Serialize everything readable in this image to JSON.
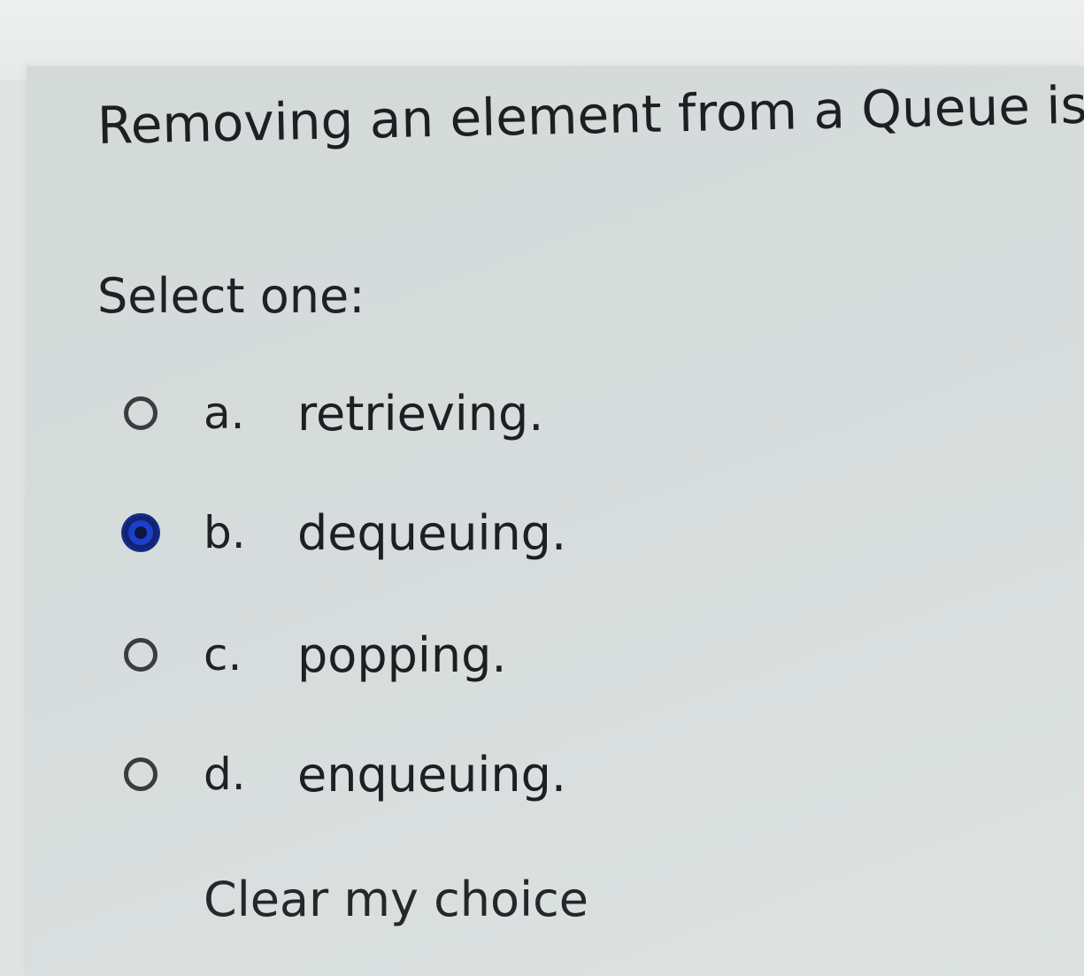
{
  "question": {
    "text": "Removing an element from a Queue is",
    "prompt": "Select one:"
  },
  "options": [
    {
      "letter": "a.",
      "text": "retrieving.",
      "selected": false
    },
    {
      "letter": "b.",
      "text": "dequeuing.",
      "selected": true
    },
    {
      "letter": "c.",
      "text": "popping.",
      "selected": false
    },
    {
      "letter": "d.",
      "text": "enqueuing.",
      "selected": false
    }
  ],
  "actions": {
    "clear_label": "Clear my choice"
  },
  "colors": {
    "selected_radio": "#1d3fcf",
    "text": "#1d1f22",
    "background": "#d6dcdb"
  }
}
